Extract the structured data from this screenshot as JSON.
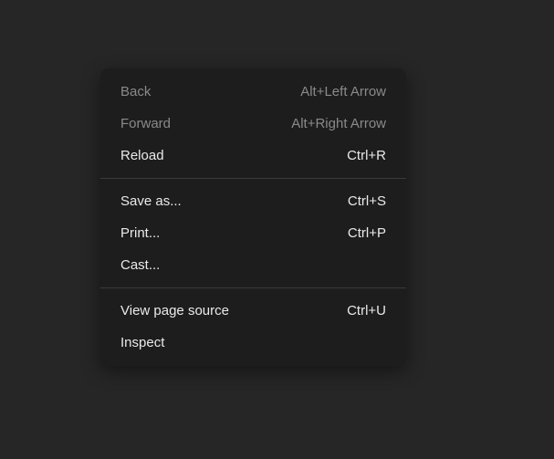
{
  "menu": {
    "groups": [
      [
        {
          "name": "back",
          "label": "Back",
          "shortcut": "Alt+Left Arrow",
          "enabled": false
        },
        {
          "name": "forward",
          "label": "Forward",
          "shortcut": "Alt+Right Arrow",
          "enabled": false
        },
        {
          "name": "reload",
          "label": "Reload",
          "shortcut": "Ctrl+R",
          "enabled": true
        }
      ],
      [
        {
          "name": "save-as",
          "label": "Save as...",
          "shortcut": "Ctrl+S",
          "enabled": true
        },
        {
          "name": "print",
          "label": "Print...",
          "shortcut": "Ctrl+P",
          "enabled": true
        },
        {
          "name": "cast",
          "label": "Cast...",
          "shortcut": "",
          "enabled": true
        }
      ],
      [
        {
          "name": "view-page-source",
          "label": "View page source",
          "shortcut": "Ctrl+U",
          "enabled": true
        },
        {
          "name": "inspect",
          "label": "Inspect",
          "shortcut": "",
          "enabled": true
        }
      ]
    ]
  }
}
